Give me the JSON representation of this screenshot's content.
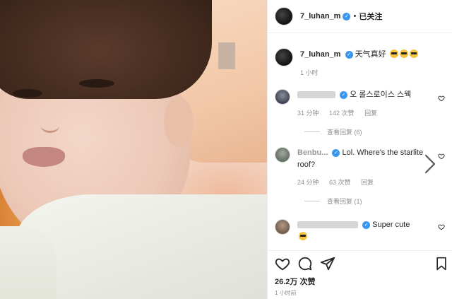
{
  "post": {
    "username": "7_luhan_m",
    "follow_status": "已关注",
    "caption": "天气真好",
    "caption_time": "1 小时",
    "likes": "26.2万 次赞",
    "posted_ago": "1 小时前"
  },
  "comments": [
    {
      "text": "오 롤스로이스 스웩",
      "time": "31 分钟",
      "likes": "142 次赞",
      "reply": "回复",
      "view_replies": "查看回复 (6)"
    },
    {
      "username": "Benbu...",
      "text": "Lol. Where's the starlite roof?",
      "time": "24 分钟",
      "likes": "63 次赞",
      "reply": "回复",
      "view_replies": "查看回复 (1)"
    },
    {
      "text": "Super cute"
    }
  ],
  "icons": {
    "verified": "verified-badge-icon",
    "heart": "heart-icon",
    "comment": "comment-icon",
    "share": "share-icon",
    "bookmark": "bookmark-icon",
    "next": "chevron-right-icon"
  },
  "colors": {
    "verified_blue": "#3897f0",
    "muted_gray": "#8e8e8e",
    "text_dark": "#262626"
  }
}
